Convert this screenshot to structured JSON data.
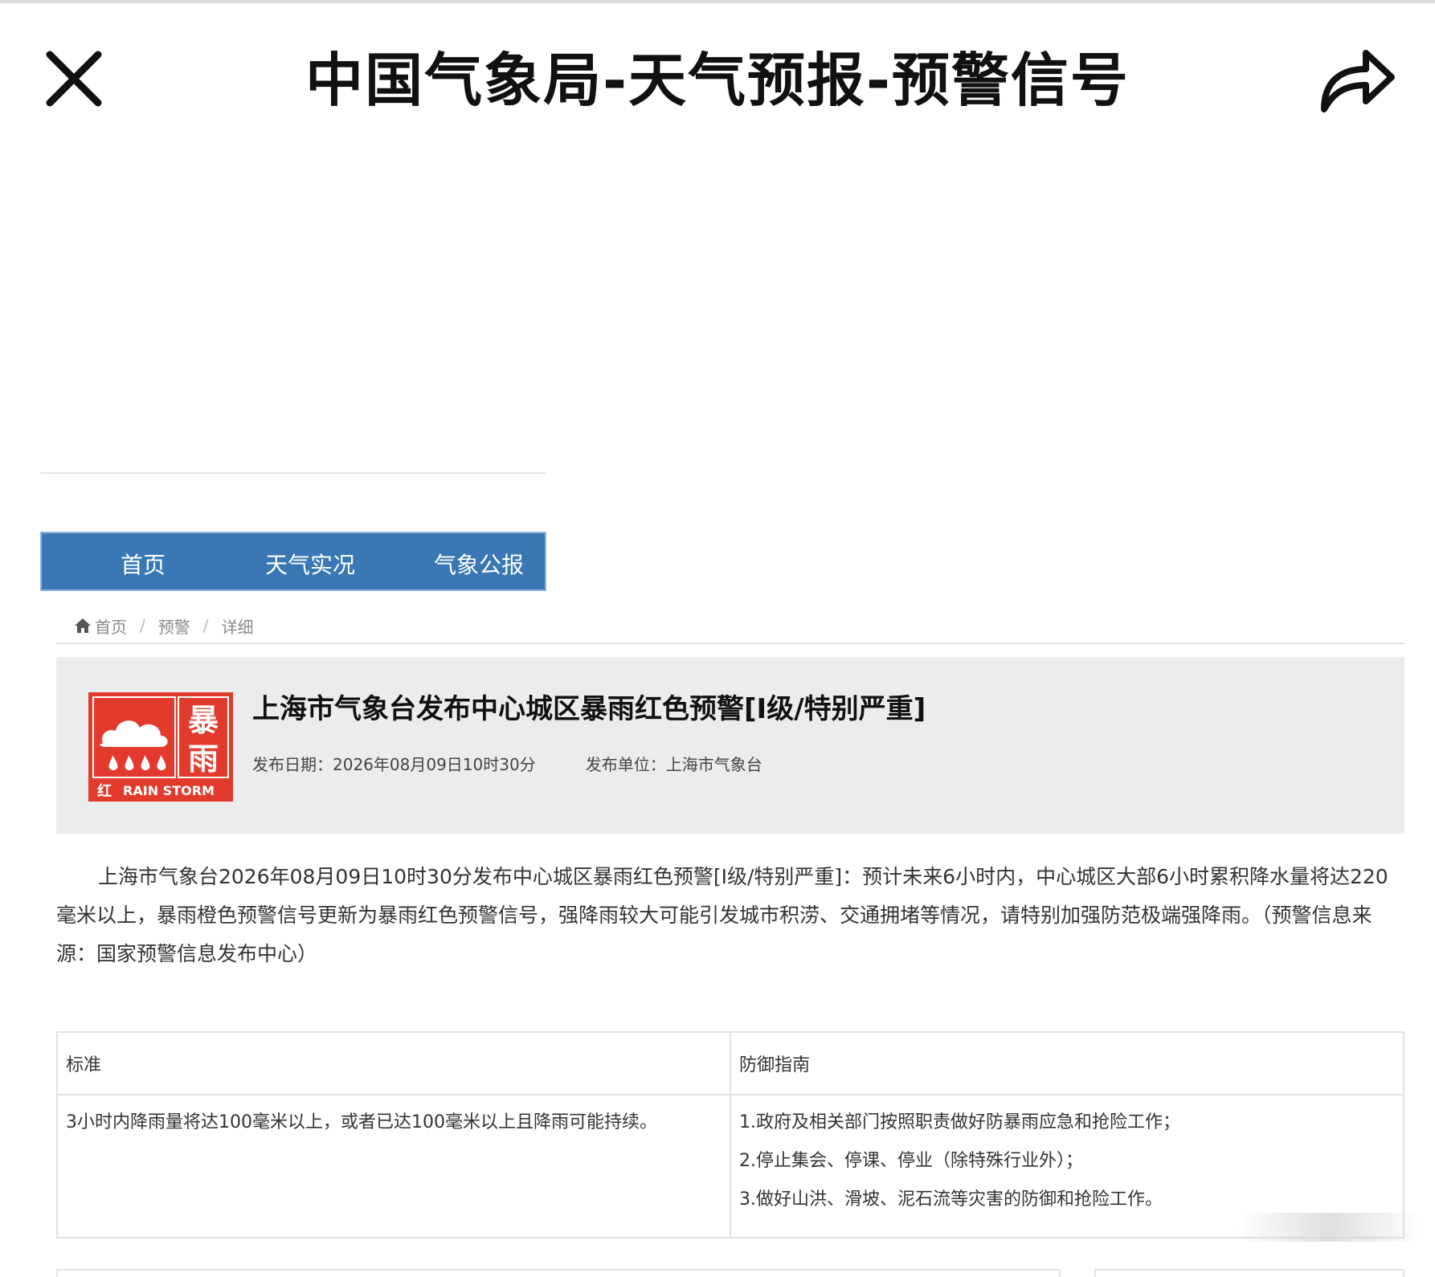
{
  "header": {
    "title": "中国气象局-天气预报-预警信号",
    "close_icon": "close-icon",
    "share_icon": "share-icon"
  },
  "nav": {
    "items": [
      {
        "label": "首页"
      },
      {
        "label": "天气实况"
      },
      {
        "label": "气象公报"
      }
    ]
  },
  "breadcrumb": {
    "home": "首页",
    "level2": "预警",
    "level3": "详细",
    "separator": "/"
  },
  "alert": {
    "icon": {
      "char1": "暴",
      "char2": "雨",
      "level_char": "红",
      "english": "RAIN STORM",
      "color": "#e23b2e"
    },
    "title": "上海市气象台发布中心城区暴雨红色预警[I级/特别严重]",
    "date_label": "发布日期：",
    "date_value": "2026年08月09日10时30分",
    "unit_label": "发布单位：",
    "unit_value": "上海市气象台"
  },
  "body": {
    "text": "上海市气象台2026年08月09日10时30分发布中心城区暴雨红色预警[I级/特别严重]：预计未来6小时内，中心城区大部6小时累积降水量将达220毫米以上，暴雨橙色预警信号更新为暴雨红色预警信号，强降雨较大可能引发城市积涝、交通拥堵等情况，请特别加强防范极端强降雨。（预警信息来源：国家预警信息发布中心）"
  },
  "table": {
    "headers": [
      "标准",
      "防御指南"
    ],
    "standard": "3小时内降雨量将达100毫米以上，或者已达100毫米以上且降雨可能持续。",
    "guide": [
      "1.政府及相关部门按照职责做好防暴雨应急和抢险工作；",
      "2.停止集会、停课、停业（除特殊行业外）；",
      "3.做好山洪、滑坡、泥石流等灾害的防御和抢险工作。"
    ]
  },
  "colors": {
    "nav_bg": "#3a78b5",
    "alert_red": "#e23b2e",
    "card_bg": "#ececec"
  }
}
